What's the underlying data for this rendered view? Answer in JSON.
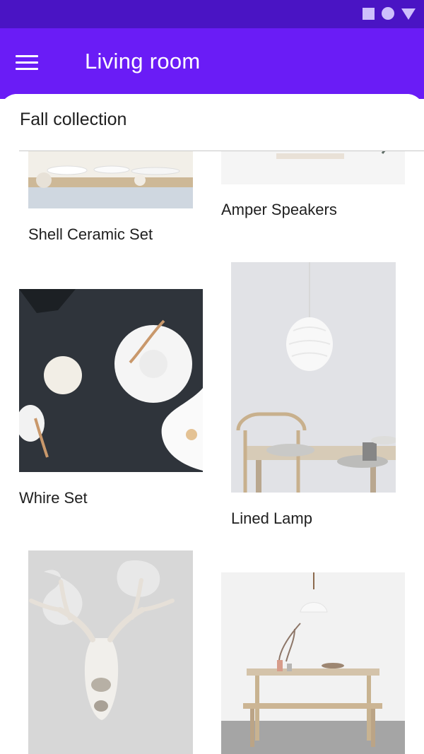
{
  "status_bar": {
    "icons": [
      "square-icon",
      "circle-icon",
      "triangle-icon"
    ]
  },
  "app_bar": {
    "title": "Living room",
    "menu_icon": "hamburger-menu-icon"
  },
  "sheet": {
    "title": "Fall collection"
  },
  "products": [
    {
      "label": "Shell Ceramic Set"
    },
    {
      "label": "Amper Speakers"
    },
    {
      "label": "Whire Set"
    },
    {
      "label": "Lined Lamp"
    },
    {
      "label": ""
    },
    {
      "label": ""
    }
  ],
  "colors": {
    "status_bar": "#4a14c4",
    "app_bar": "#6a1cf6",
    "surface": "#ffffff",
    "text": "#1f1f1f"
  }
}
